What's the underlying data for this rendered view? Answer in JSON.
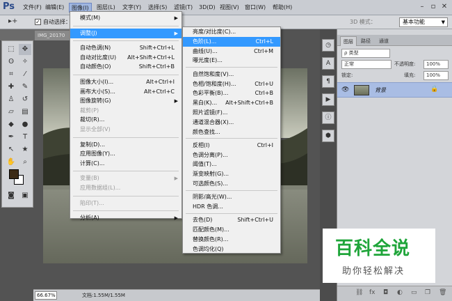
{
  "app": {
    "logo": "Ps"
  },
  "menubar": {
    "items": [
      "文件(F)",
      "编辑(E)",
      "图像(I)",
      "图层(L)",
      "文字(Y)",
      "选择(S)",
      "滤镜(T)",
      "3D(D)",
      "视图(V)",
      "窗口(W)",
      "帮助(H)"
    ],
    "active_index": 2
  },
  "options": {
    "auto_select_label": "自动选择：",
    "mode_3d_label": "3D 模式：",
    "workspace": "基本功能"
  },
  "document": {
    "tab_label": "IMG_20170",
    "zoom": "66.67%",
    "doc_info": "文档:1.55M/1.55M"
  },
  "image_menu": [
    {
      "label": "模式(M)",
      "arrow": true
    },
    {
      "sep": true
    },
    {
      "label": "调整(J)",
      "arrow": true,
      "highlight": true
    },
    {
      "sep": true
    },
    {
      "label": "自动色调(N)",
      "shortcut": "Shift+Ctrl+L"
    },
    {
      "label": "自动对比度(U)",
      "shortcut": "Alt+Shift+Ctrl+L"
    },
    {
      "label": "自动颜色(O)",
      "shortcut": "Shift+Ctrl+B"
    },
    {
      "sep": true
    },
    {
      "label": "图像大小(I)...",
      "shortcut": "Alt+Ctrl+I"
    },
    {
      "label": "画布大小(S)...",
      "shortcut": "Alt+Ctrl+C"
    },
    {
      "label": "图像旋转(G)",
      "arrow": true
    },
    {
      "label": "裁剪(P)",
      "disabled": true
    },
    {
      "label": "裁切(R)..."
    },
    {
      "label": "显示全部(V)",
      "disabled": true
    },
    {
      "sep": true
    },
    {
      "label": "复制(D)..."
    },
    {
      "label": "应用图像(Y)..."
    },
    {
      "label": "计算(C)..."
    },
    {
      "sep": true
    },
    {
      "label": "变量(B)",
      "arrow": true,
      "disabled": true
    },
    {
      "label": "应用数据组(L)...",
      "disabled": true
    },
    {
      "sep": true
    },
    {
      "label": "陷印(T)...",
      "disabled": true
    },
    {
      "sep": true
    },
    {
      "label": "分析(A)",
      "arrow": true
    }
  ],
  "adjust_menu": [
    {
      "label": "亮度/对比度(C)..."
    },
    {
      "label": "色阶(L)...",
      "shortcut": "Ctrl+L",
      "highlight": true
    },
    {
      "label": "曲线(U)...",
      "shortcut": "Ctrl+M"
    },
    {
      "label": "曝光度(E)..."
    },
    {
      "sep": true
    },
    {
      "label": "自然饱和度(V)..."
    },
    {
      "label": "色相/饱和度(H)...",
      "shortcut": "Ctrl+U"
    },
    {
      "label": "色彩平衡(B)...",
      "shortcut": "Ctrl+B"
    },
    {
      "label": "黑白(K)...",
      "shortcut": "Alt+Shift+Ctrl+B"
    },
    {
      "label": "照片滤镜(F)..."
    },
    {
      "label": "通道混合器(X)..."
    },
    {
      "label": "颜色查找..."
    },
    {
      "sep": true
    },
    {
      "label": "反相(I)",
      "shortcut": "Ctrl+I"
    },
    {
      "label": "色调分离(P)..."
    },
    {
      "label": "阈值(T)..."
    },
    {
      "label": "渐变映射(G)..."
    },
    {
      "label": "可选颜色(S)..."
    },
    {
      "sep": true
    },
    {
      "label": "阴影/高光(W)..."
    },
    {
      "label": "HDR 色调..."
    },
    {
      "sep": true
    },
    {
      "label": "去色(D)",
      "shortcut": "Shift+Ctrl+U"
    },
    {
      "label": "匹配颜色(M)..."
    },
    {
      "label": "替换颜色(R)..."
    },
    {
      "label": "色调均化(Q)"
    }
  ],
  "layers_panel": {
    "tabs": [
      "图层",
      "路径",
      "通道"
    ],
    "filter_label": "ρ 类型",
    "blend_mode": "正常",
    "opacity_label": "不透明度:",
    "opacity_value": "100%",
    "lock_label": "锁定:",
    "fill_label": "填充:",
    "fill_value": "100%",
    "layer_name": "背景"
  },
  "watermark": {
    "title": "百科全说",
    "subtitle": "助你轻松解决"
  },
  "colors": {
    "menu_highlight": "#3399ff",
    "layer_selected": "#a9bde4",
    "watermark_green": "#1fa53a"
  }
}
